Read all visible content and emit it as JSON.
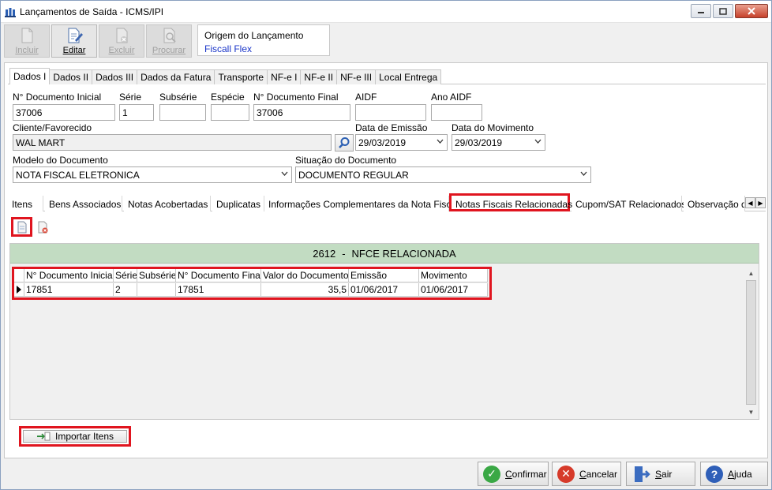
{
  "window": {
    "title": "Lançamentos de Saída - ICMS/IPI"
  },
  "toolbar": {
    "incluir": "Incluir",
    "editar": "Editar",
    "excluir": "Excluir",
    "procurar": "Procurar"
  },
  "origin": {
    "label": "Origem do Lançamento",
    "value": "Fiscall Flex"
  },
  "tabs": [
    "Dados I",
    "Dados II",
    "Dados III",
    "Dados da Fatura",
    "Transporte",
    "NF-e I",
    "NF-e II",
    "NF-e III",
    "Local Entrega"
  ],
  "form": {
    "doc_inicial_label": "N° Documento Inicial",
    "doc_inicial": "37006",
    "serie_label": "Série",
    "serie": "1",
    "subserie_label": "Subsérie",
    "subserie": "",
    "especie_label": "Espécie",
    "especie": "",
    "doc_final_label": "N° Documento Final",
    "doc_final": "37006",
    "aidf_label": "AIDF",
    "aidf": "",
    "ano_aidf_label": "Ano AIDF",
    "ano_aidf": "",
    "cliente_label": "Cliente/Favorecido",
    "cliente": "WAL MART",
    "data_emissao_label": "Data de Emissão",
    "data_emissao": "29/03/2019",
    "data_movimento_label": "Data do Movimento",
    "data_movimento": "29/03/2019",
    "modelo_label": "Modelo do Documento",
    "modelo": "NOTA FISCAL ELETRONICA",
    "situacao_label": "Situação do Documento",
    "situacao": "DOCUMENTO REGULAR"
  },
  "subtabs": [
    "Itens",
    "Bens Associados",
    "Notas Acobertadas",
    "Duplicatas",
    "Informações Complementares da Nota Fiscal",
    "Notas Fiscais Relacionadas",
    "Cupom/SAT Relacionados",
    "Observação d"
  ],
  "grid": {
    "title_code": "2612",
    "title_sep": "-",
    "title_text": "NFCE RELACIONADA",
    "columns": [
      "N° Documento Inicial",
      "Série",
      "Subsérie",
      "N° Documento Final",
      "Valor do Documento",
      "Emissão",
      "Movimento"
    ],
    "rows": [
      [
        "17851",
        "2",
        "",
        "17851",
        "35,5",
        "01/06/2017",
        "01/06/2017"
      ]
    ]
  },
  "import_button": "Importar Itens",
  "buttons": {
    "confirmar": "Confirmar",
    "cancelar": "Cancelar",
    "sair": "Sair",
    "ajuda": "Ajuda"
  },
  "colors": {
    "highlight": "#e0151f",
    "grid_title_bg": "#c2dcc2",
    "link_blue": "#1a35c8"
  }
}
